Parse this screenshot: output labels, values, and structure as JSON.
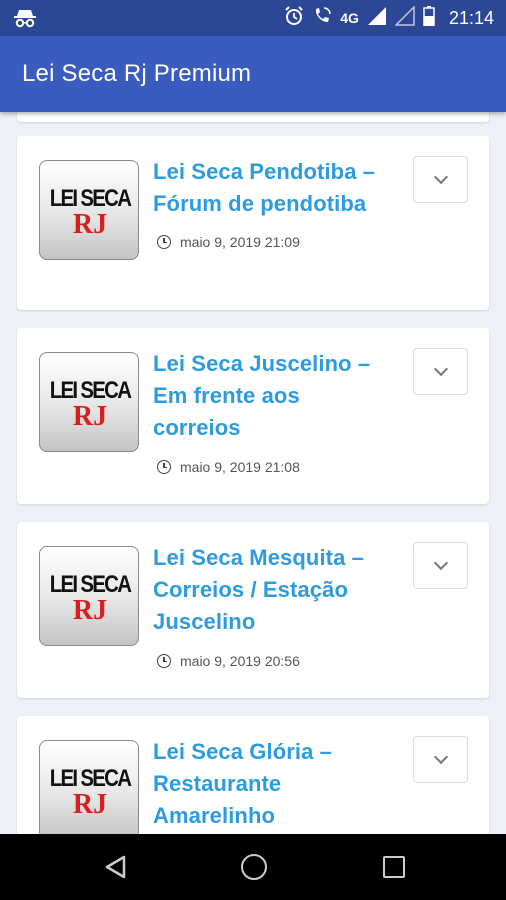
{
  "status_bar": {
    "network": "4G",
    "time": "21:14"
  },
  "app_bar": {
    "title": "Lei Seca Rj Premium"
  },
  "thumbnail": {
    "line1": "LEI SECA",
    "line2": "RJ"
  },
  "posts": [
    {
      "title_line1": "Lei Seca Pendotiba –",
      "title_line2": "Fórum de pendotiba",
      "title_line3": "",
      "date": "maio 9, 2019 21:09"
    },
    {
      "title_line1": "Lei Seca Juscelino –",
      "title_line2": "Em frente aos",
      "title_line3": "correios",
      "date": "maio 9, 2019 21:08"
    },
    {
      "title_line1": "Lei Seca Mesquita –",
      "title_line2": "Correios / Estação",
      "title_line3": "Juscelino",
      "date": "maio 9, 2019 20:56"
    },
    {
      "title_line1": "Lei Seca Glória –",
      "title_line2": "Restaurante",
      "title_line3": "Amarelinho",
      "date": ""
    }
  ],
  "colors": {
    "status_bar": "#2b4796",
    "app_bar": "#3a5bbf",
    "link_title": "#2d9be0",
    "thumbnail_rj": "#d81e1e",
    "background": "#eef0f8"
  }
}
